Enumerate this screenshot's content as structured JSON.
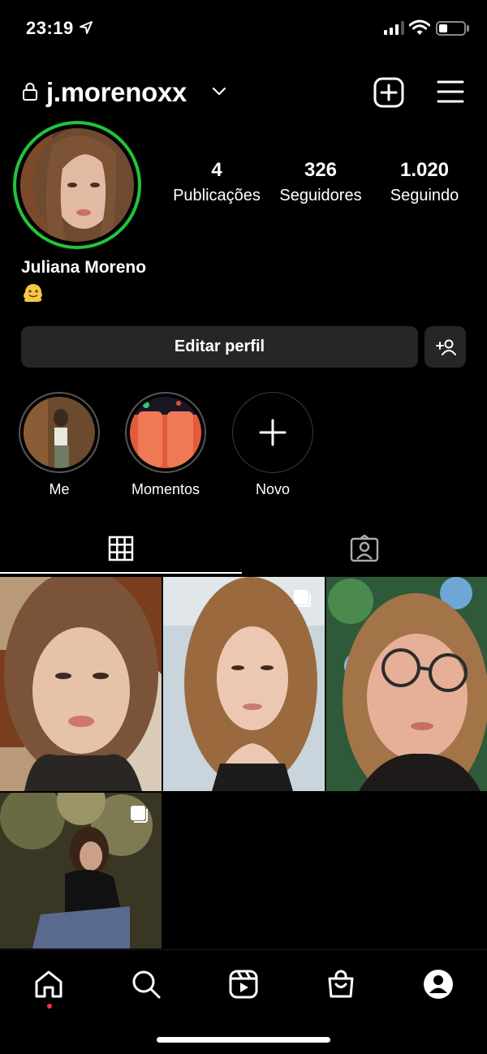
{
  "status": {
    "time": "23:19"
  },
  "header": {
    "username": "j.morenoxx"
  },
  "profile": {
    "stats": [
      {
        "value": "4",
        "label": "Publicações"
      },
      {
        "value": "326",
        "label": "Seguidores"
      },
      {
        "value": "1.020",
        "label": "Seguindo"
      }
    ],
    "full_name": "Juliana Moreno",
    "bio_emoji": "melting-face-emoji"
  },
  "actions": {
    "edit_label": "Editar perfil"
  },
  "highlights": [
    {
      "label": "Me"
    },
    {
      "label": "Momentos"
    },
    {
      "label": "Novo"
    }
  ],
  "tabs": [
    {
      "icon": "grid-icon"
    },
    {
      "icon": "tagged-icon"
    }
  ],
  "colors": {
    "background": "#000000",
    "button_bg": "#262626",
    "story_ring": "#21c43a",
    "notification": "#ff2d4b"
  },
  "nav": [
    {
      "icon": "home-icon"
    },
    {
      "icon": "search-icon"
    },
    {
      "icon": "reels-icon"
    },
    {
      "icon": "shop-icon"
    },
    {
      "icon": "profile-icon"
    }
  ]
}
